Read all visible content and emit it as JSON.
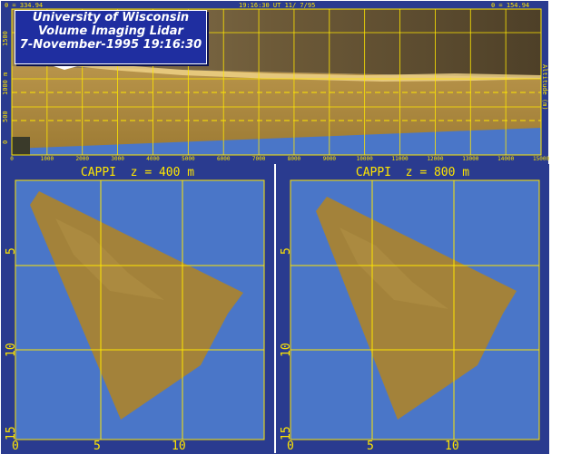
{
  "rhi": {
    "header_left": "θ = 334.94",
    "header_mid": "19:16:30 UT 11/ 7/95",
    "header_right": "θ = 154.94",
    "y_label": "Altitude (m)",
    "y_ticks": [
      "0",
      "500",
      "1000 m",
      "1500"
    ],
    "x_ticks": [
      "0",
      "1000",
      "2000",
      "3000",
      "4000",
      "5000",
      "6000",
      "7000",
      "8000",
      "9000",
      "10000",
      "11000",
      "12000",
      "13000",
      "14000",
      "15000"
    ]
  },
  "title_box": {
    "line1": "University of Wisconsin",
    "line2": "Volume Imaging Lidar",
    "line3": "7-November-1995 19:16:30"
  },
  "cappi_left": {
    "title": "CAPPI  z = 400 m",
    "y_ticks": [
      "5",
      "10",
      "15"
    ],
    "x_ticks": [
      "0",
      "5",
      "10"
    ]
  },
  "cappi_right": {
    "title": "CAPPI  z = 800 m",
    "y_ticks": [
      "5",
      "10",
      "15"
    ],
    "x_ticks": [
      "0",
      "5",
      "10"
    ]
  },
  "colors": {
    "frame": "#2a3b8f",
    "sky": "#4a76c8",
    "grid": "#ffe600",
    "aerosol": "#a8843a"
  }
}
